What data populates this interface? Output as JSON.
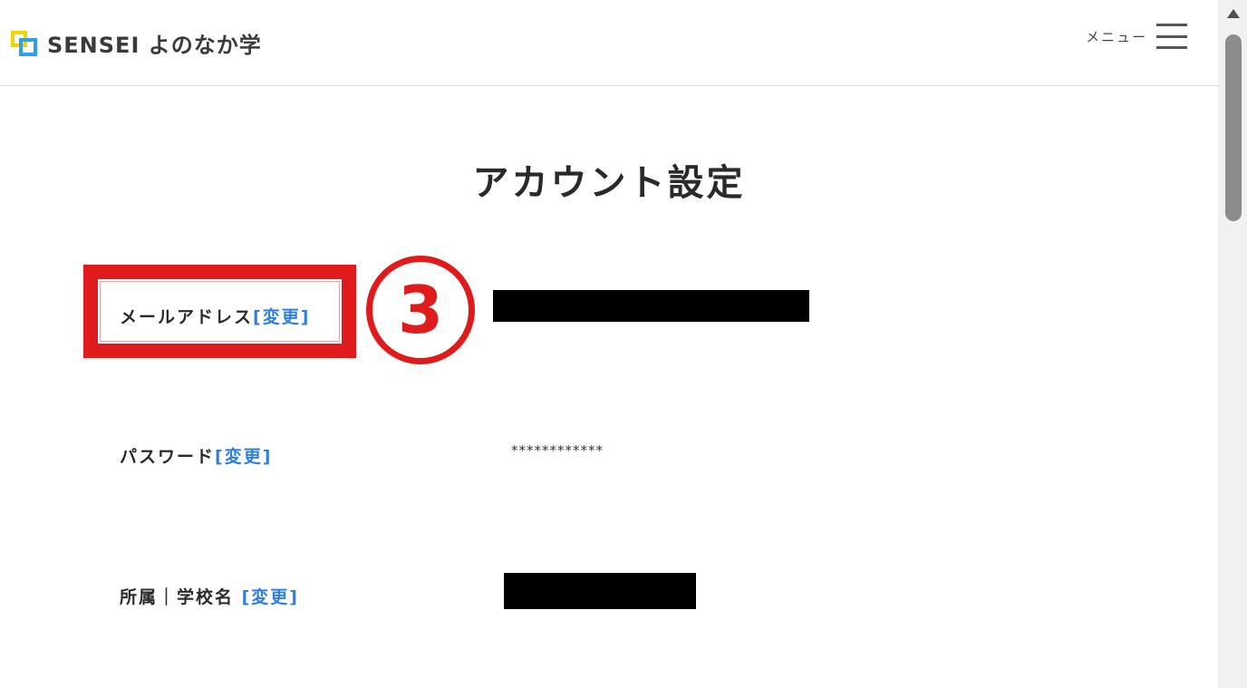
{
  "header": {
    "logo_text": "SENSEI よのなか学",
    "menu_label": "メニュー"
  },
  "main": {
    "title": "アカウント設定",
    "rows": [
      {
        "label": "メールアドレス",
        "change_label": "[変更]",
        "value_redacted": true
      },
      {
        "label": "パスワード",
        "change_label": "[変更]",
        "value": "************"
      },
      {
        "label": "所属｜学校名 ",
        "change_label": "[変更]",
        "value_redacted": true
      }
    ]
  },
  "annotation": {
    "step_number": "3",
    "highlight_color": "#e01b1b"
  },
  "colors": {
    "link": "#2f7fe0",
    "logo_yellow": "#f2d400",
    "logo_blue": "#2ea0e8"
  }
}
